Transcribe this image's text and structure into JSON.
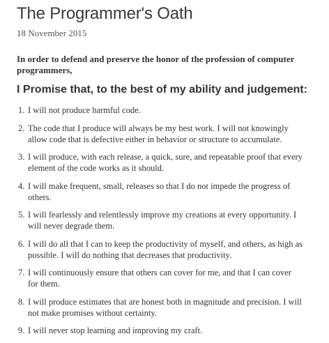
{
  "document": {
    "title": "The Programmer's Oath",
    "date": "18 November 2015",
    "intro": "In order to defend and preserve the honor of the profession of computer programmers,",
    "promise_heading": "I Promise that, to the best of my ability and judgement:",
    "oath_items": [
      {
        "num": "1.",
        "text": "I will not produce harmful code."
      },
      {
        "num": "2.",
        "text": "The code that I produce will always be my best work. I will not knowingly allow code that is defective either in behavior or structure to accumulate."
      },
      {
        "num": "3.",
        "text": "I will produce, with each release, a quick, sure, and repeatable proof that every element of the code works as it should."
      },
      {
        "num": "4.",
        "text": "I will make frequent, small, releases so that I do not impede the progress of others."
      },
      {
        "num": "5.",
        "text": "I will fearlessly and relentlessly improve my creations at every opportunity. I will never degrade them."
      },
      {
        "num": "6.",
        "text": "I will do all that I can to keep the productivity of myself, and others, as high as possible. I will do nothing that decreases that productivity."
      },
      {
        "num": "7.",
        "text": "I will continuously ensure that others can cover for me, and that I can cover for them."
      },
      {
        "num": "8.",
        "text": "I will produce estimates that are honest both in magnitude and precision. I will not make promises without certainty."
      },
      {
        "num": "9.",
        "text": "I will never stop learning and improving my craft."
      }
    ]
  },
  "colors": {
    "text": "#333333",
    "title": "#3a3a3a",
    "date": "#555555",
    "background": "#ffffff"
  }
}
